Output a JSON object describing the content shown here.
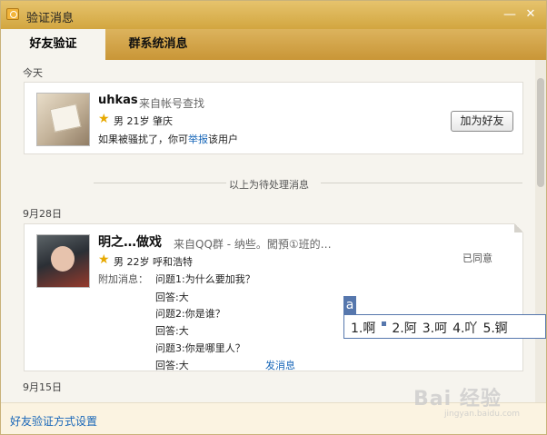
{
  "window": {
    "title": "验证消息",
    "min_glyph": "—",
    "close_glyph": "✕"
  },
  "tabs": [
    {
      "label": "好友验证",
      "active": true
    },
    {
      "label": "群系统消息",
      "active": false
    }
  ],
  "sections": {
    "today": "今天",
    "pending_divider": "以上为待处理消息",
    "sep28": "9月28日",
    "sep15": "9月15日"
  },
  "requests": [
    {
      "name": "uhkas",
      "source": "来自帐号查找",
      "gender_age_location": "男 21岁 肇庆",
      "message_prefix": "如果被骚扰了，你可",
      "message_link": "举报",
      "message_suffix": "该用户",
      "action_label": "加为好友"
    },
    {
      "name": "明之…做戏",
      "source": "来自QQ群 - 纳些。闖預①班的…",
      "gender_age_location": "男 22岁 呼和浩特",
      "status": "已同意",
      "extra_label": "附加消息：",
      "qa": [
        "问题1:为什么要加我？",
        "回答:大",
        "问题2:你是谁？",
        "回答:大",
        "问题3:你是哪里人？",
        "回答:大"
      ],
      "send_link": "发消息"
    }
  ],
  "footer": {
    "link": "好友验证方式设置"
  },
  "ime": {
    "indicator": "a",
    "candidates": [
      "1.啊",
      "2.阿",
      "3.呵",
      "4.吖",
      "5.锕"
    ]
  },
  "watermark": {
    "main": "Bai 经验",
    "sub": "jingyan.baidu.com"
  },
  "colors": {
    "title_bar": "#d2a640",
    "link": "#1766b8",
    "ime_border": "#5677ad"
  }
}
